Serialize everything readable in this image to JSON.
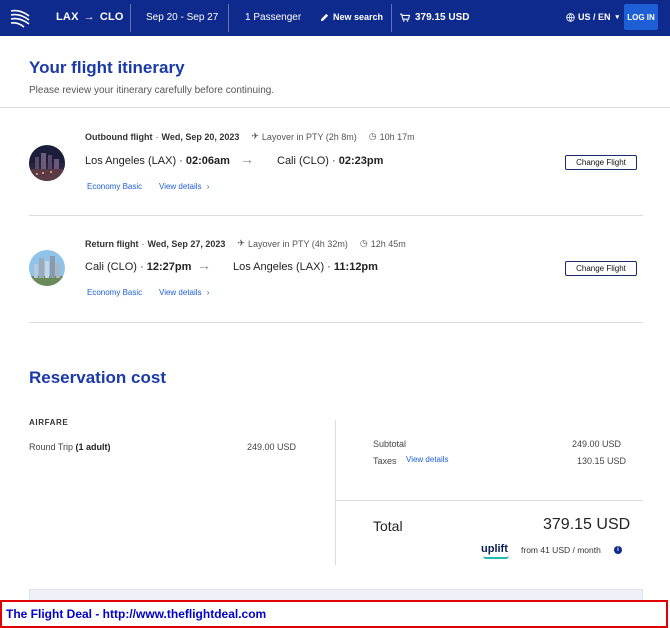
{
  "header": {
    "from": "LAX",
    "to": "CLO",
    "dates": "Sep 20 - Sep 27",
    "passengers": "1 Passenger",
    "new_search": "New search",
    "price": "379.15 USD",
    "locale": "US / EN",
    "login": "LOG IN"
  },
  "itinerary": {
    "title": "Your flight itinerary",
    "subtitle": "Please review your itinerary carefully before continuing."
  },
  "flights": [
    {
      "label": "Outbound flight",
      "date": "Wed, Sep 20, 2023",
      "layover": "Layover in PTY (2h 8m)",
      "duration": "10h 17m",
      "origin": "Los Angeles (LAX)",
      "depart": "02:06am",
      "destination": "Cali (CLO)",
      "arrive": "02:23pm",
      "class": "Economy Basic",
      "details": "View details",
      "change": "Change Flight"
    },
    {
      "label": "Return flight",
      "date": "Wed, Sep 27, 2023",
      "layover": "Layover in PTY (4h 32m)",
      "duration": "12h 45m",
      "origin": "Cali (CLO)",
      "depart": "12:27pm",
      "destination": "Los Angeles (LAX)",
      "arrive": "11:12pm",
      "class": "Economy Basic",
      "details": "View details",
      "change": "Change Flight"
    }
  ],
  "cost": {
    "title": "Reservation cost",
    "airfare_label": "AIRFARE",
    "trip_type": "Round Trip",
    "trip_count": "(1 adult)",
    "airfare_price": "249.00 USD",
    "subtotal_label": "Subtotal",
    "subtotal": "249.00 USD",
    "taxes_label": "Taxes",
    "taxes_details": "View details",
    "taxes": "130.15 USD",
    "total_label": "Total",
    "total": "379.15 USD",
    "uplift_brand": "uplift",
    "monthly": "from 41 USD / month"
  },
  "watermark": "The Flight Deal - http://www.theflightdeal.com",
  "colors": {
    "navy": "#0e2a8c",
    "accent": "#1f5fd6",
    "title": "#1a3aa8",
    "watermark_border": "#e00000"
  }
}
